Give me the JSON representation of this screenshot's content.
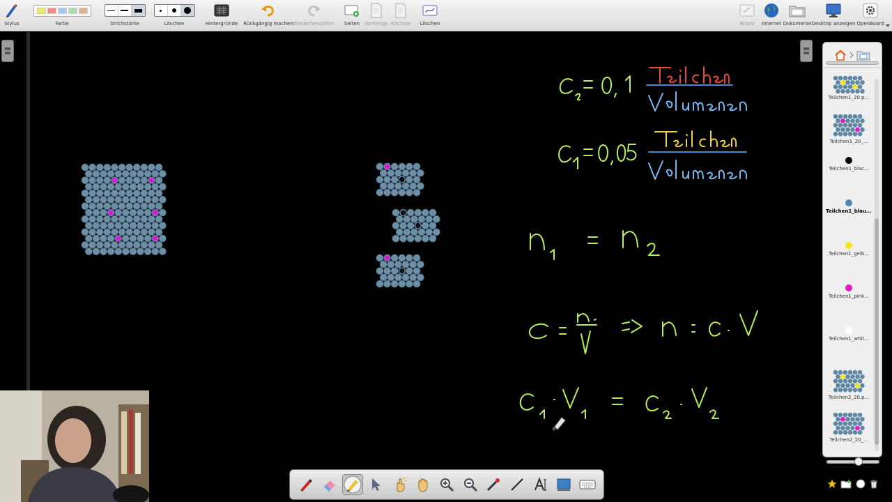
{
  "toolbar": {
    "left": [
      {
        "label": "Stylus",
        "icon": "stylus-icon"
      },
      {
        "label": "Farbe",
        "icon": "color-palette"
      },
      {
        "label": "Strichstärke",
        "icon": "line-width-selector"
      },
      {
        "label": "Löschen",
        "icon": "eraser-size-selector"
      },
      {
        "label": "Hintergründe",
        "icon": "backgrounds-icon"
      },
      {
        "label": "Rückgängig machen",
        "icon": "undo-icon"
      },
      {
        "label": "Wiederherstellen",
        "icon": "redo-icon",
        "disabled": true
      },
      {
        "label": "Seiten",
        "icon": "add-page-icon"
      },
      {
        "label": "Vorherige",
        "icon": "previous-page-icon",
        "disabled": true
      },
      {
        "label": "Nächste",
        "icon": "next-page-icon",
        "disabled": true
      },
      {
        "label": "Löschen",
        "icon": "clear-page-icon"
      }
    ],
    "right": [
      {
        "label": "Board",
        "icon": "board-icon",
        "disabled": true
      },
      {
        "label": "Internet",
        "icon": "globe-icon"
      },
      {
        "label": "Dokumente",
        "icon": "folder-icon"
      },
      {
        "label": "Desktop anzeigen",
        "icon": "monitor-icon"
      },
      {
        "label": "OpenBoard",
        "icon": "settings-gear-icon"
      }
    ],
    "colors": [
      "#e8e86a",
      "#f08a8a",
      "#a8c8f0",
      "#a8e0a8",
      "#e0b48a"
    ]
  },
  "board": {
    "equations": [
      "c₂ = 0,1 Teilchen / Volumen",
      "c₁ = 0,05 Teilchen / Volumen",
      "n₁ = n₂",
      "c = n / V ⇒ n = c · V",
      "c₁ · V₁ = c₂ · V₂"
    ]
  },
  "palette": {
    "tools": [
      "pen-tool",
      "eraser-tool",
      "marker-tool",
      "selector-tool",
      "interactor-tool",
      "hand-tool",
      "zoom-in-tool",
      "zoom-out-tool",
      "laser-pointer-tool",
      "line-tool",
      "text-tool",
      "capture-tool",
      "keyboard-tool"
    ],
    "selected": "marker-tool"
  },
  "library": {
    "items": [
      {
        "label": "Teilchen1_20.p...",
        "thumb": "blue-grid-yellow"
      },
      {
        "label": "Teilchen1_20_...",
        "thumb": "blue-grid-pink"
      },
      {
        "label": "Teilchen1_blac...",
        "thumb": "black-dot"
      },
      {
        "label": "Teilchen1_blau...",
        "thumb": "blue-dot",
        "highlighted": true
      },
      {
        "label": "Teilchen1_gelb...",
        "thumb": "yellow-dot"
      },
      {
        "label": "Teilchen1_pink...",
        "thumb": "pink-dot"
      },
      {
        "label": "Teilchen1_whit...",
        "thumb": "white-dot"
      },
      {
        "label": "Teilchen2_20.p...",
        "thumb": "blue-grid-yellow-2"
      },
      {
        "label": "Teilchen2_20_...",
        "thumb": "blue-grid-pink-2"
      }
    ]
  }
}
